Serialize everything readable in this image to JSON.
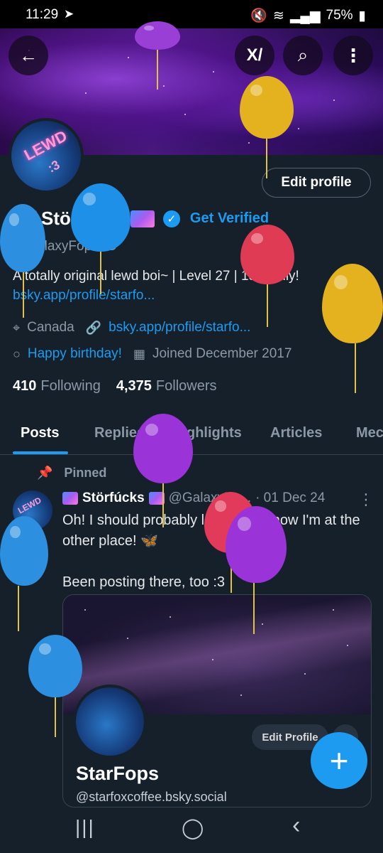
{
  "status_bar": {
    "time": "11:29",
    "battery": "75%"
  },
  "header": {
    "back_icon": "arrow-left-icon",
    "grok_icon": "grok-icon",
    "search_icon": "search-icon",
    "more_icon": "more-vertical-icon"
  },
  "profile": {
    "edit_profile_label": "Edit profile",
    "display_name": "Störfúcks",
    "get_verified_label": "Get Verified",
    "handle": "@GalaxyFopsAD",
    "bio": "A totally original lewd boi~ | Level 27 | 18+ Only!",
    "bio_link": "bsky.app/profile/starfo...",
    "location": "Canada",
    "website": "bsky.app/profile/starfo...",
    "birthday": "Happy birthday!",
    "joined": "Joined December 2017",
    "following_count": "410",
    "following_label": "Following",
    "followers_count": "4,375",
    "followers_label": "Followers",
    "avatar_text": "LEWD",
    "avatar_subtext": ":3"
  },
  "tabs": [
    "Posts",
    "Replies",
    "Highlights",
    "Articles",
    "Media"
  ],
  "visible_tab_last": "Mec",
  "pinned_post": {
    "pinned_label": "Pinned",
    "author_name": "Störfúcks",
    "author_handle": "@GalaxyFo...",
    "date": "· 01 Dec 24",
    "text_line1": "Oh! I should probably let you all know I'm at the other place! 🦋",
    "text_line2": "Been posting there, too :3",
    "card": {
      "edit_label": "Edit Profile",
      "name": "StarFops",
      "handle": "@starfoxcoffee.bsky.social"
    }
  },
  "fab_label": "+",
  "nav": {
    "recent": "|||",
    "home": "◯",
    "back": "‹"
  },
  "colors": {
    "accent": "#1d9bf0",
    "background": "#15202b"
  }
}
